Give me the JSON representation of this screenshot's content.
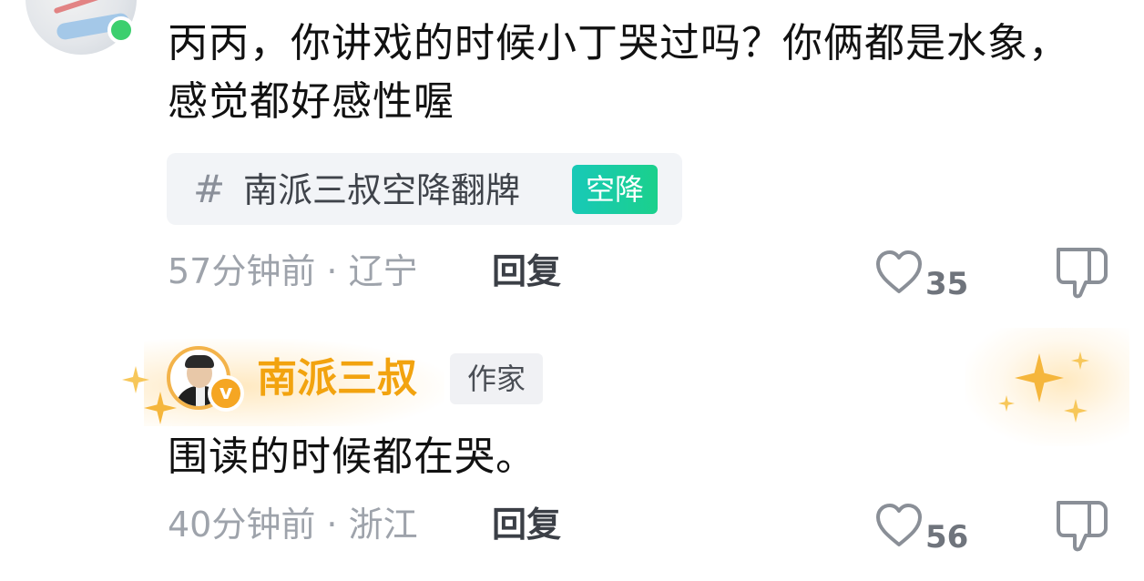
{
  "comment1": {
    "text": "丙丙，你讲戏的时候小丁哭过吗？你俩都是水象，感觉都好感性喔",
    "topic": {
      "hash": "#",
      "label": "南派三叔空降翻牌",
      "badge": "空降"
    },
    "time": "57分钟前 · 辽宁",
    "reply_label": "回复",
    "like_count": "35",
    "icons": {
      "like": "heart-outline-icon",
      "dislike": "thumb-down-icon"
    }
  },
  "comment2": {
    "author": {
      "name": "南派三叔",
      "tag": "作家",
      "verified_badge": "v"
    },
    "text": "围读的时候都在哭。",
    "time": "40分钟前 · 浙江",
    "reply_label": "回复",
    "like_count": "56",
    "icons": {
      "like": "heart-outline-icon",
      "dislike": "thumb-down-icon"
    }
  },
  "colors": {
    "author_name": "#f2a30f",
    "topic_badge": "#1bd08c",
    "online_dot": "#3ccf6e",
    "meta_text": "#9ea3ab"
  }
}
